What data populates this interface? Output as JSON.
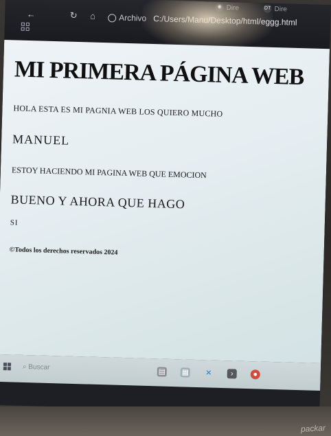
{
  "browser": {
    "tabs": [
      {
        "label": "Dire",
        "icon": "globe-icon"
      },
      {
        "label": "Dire",
        "icon": "DT"
      }
    ],
    "address_label": "Archivo",
    "address_url": "C:/Users/Manu/Desktop/html/eggg.html"
  },
  "page": {
    "title": "MI PRIMERA PÁGINA WEB",
    "greeting": "HOLA ESTA ES MI PAGNIA WEB LOS QUIERO MUCHO",
    "name_heading": "MANUEL",
    "progress_text": "ESTOY HACIENDO MI PAGINA WEB QUE EMOCION",
    "question_heading": "BUENO Y AHORA QUE HAGO",
    "answer_text": "SI",
    "footer": "©Todos los derechos reservados 2024"
  },
  "taskbar": {
    "search_placeholder": "Buscar",
    "pinned_icons": [
      "file-explorer-icon",
      "store-icon",
      "vscode-icon",
      "terminal-icon",
      "chrome-icon"
    ]
  },
  "device": {
    "brand": "packar"
  },
  "colors": {
    "page_background": "#e6eef2",
    "text": "#141414",
    "browser_chrome": "#1f2026"
  }
}
